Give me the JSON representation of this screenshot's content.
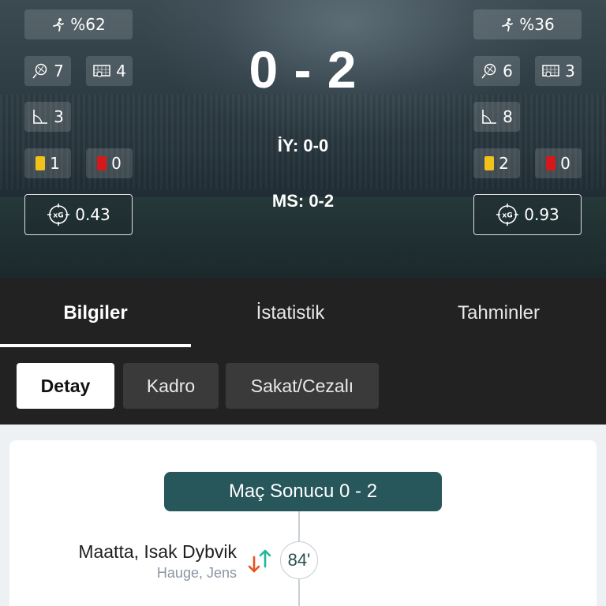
{
  "match": {
    "score": "0 - 2",
    "half_time": "İY: 0-0",
    "full_time": "MS: 0-2"
  },
  "home": {
    "possession": "%62",
    "shots": "7",
    "shots_on_target": "4",
    "corners": "3",
    "yellow_cards": "1",
    "red_cards": "0",
    "xg": "0.43"
  },
  "away": {
    "possession": "%36",
    "shots": "6",
    "shots_on_target": "3",
    "corners": "8",
    "yellow_cards": "2",
    "red_cards": "0",
    "xg": "0.93"
  },
  "tabs": [
    {
      "label": "Bilgiler",
      "active": true
    },
    {
      "label": "İstatistik",
      "active": false
    },
    {
      "label": "Tahminler",
      "active": false
    }
  ],
  "subtabs": [
    {
      "label": "Detay",
      "active": true
    },
    {
      "label": "Kadro",
      "active": false
    },
    {
      "label": "Sakat/Cezalı",
      "active": false
    }
  ],
  "timeline": {
    "result_banner": "Maç Sonucu 0 - 2",
    "events": [
      {
        "minute": "84'",
        "player_in": "Maatta, Isak Dybvik",
        "player_out": "Hauge, Jens",
        "type": "substitution",
        "side": "home"
      }
    ]
  },
  "colors": {
    "banner": "#27565b",
    "yellow_card": "#f2c21a",
    "red_card": "#d4191d",
    "sub_in": "#22b89a",
    "sub_out": "#e8541f"
  },
  "icons": {
    "possession": "running-player-icon",
    "shots": "ball-icon",
    "shots_on_target": "goal-net-icon",
    "corners": "corner-flag-icon",
    "xg": "xg-target-icon"
  }
}
